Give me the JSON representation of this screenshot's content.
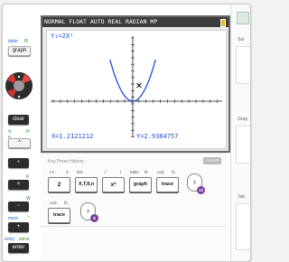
{
  "screen": {
    "status": "NORMAL FLOAT AUTO REAL RADIAN MP",
    "equation": "Y₁=2X²",
    "x_readout": "X=1.2121212",
    "y_readout": "Y=2.9384757",
    "curve_color": "#1f4fd0"
  },
  "keypad": {
    "table_label": "table",
    "f5_label": "f5",
    "graph_label": "graph",
    "clear_label": "clear",
    "pi_label": "π",
    "h_label": "H",
    "e_label": "e",
    "caret_label": "^",
    "divide_label": "÷",
    "times_label": "×",
    "minus_label": "−",
    "plus_label": "+",
    "k_label": "K",
    "w_label": "W",
    "mem_label": "mem",
    "quote_label": "\"",
    "entry_label": "entry",
    "solve_label": "solve",
    "enter_label": "enter"
  },
  "history": {
    "title": "Key Press History",
    "clear_label": "CLEAR",
    "row1": [
      {
        "sub1": "L2",
        "sub2": "Z",
        "label": "2"
      },
      {
        "sub1": "link",
        "sub2": "",
        "label": "X,T,θ,n"
      },
      {
        "sub1": "√‾",
        "sub2": "I",
        "label": "x²"
      },
      {
        "sub1": "table",
        "sub2": "f5",
        "label": "graph"
      },
      {
        "sub1": "calc",
        "sub2": "f4",
        "label": "trace"
      }
    ],
    "row1_badge": "12",
    "row2": [
      {
        "sub1": "calc",
        "sub2": "f4",
        "label": "trace"
      }
    ],
    "row2_badge": "8",
    "arrow": "›"
  },
  "side": {
    "label1": "Set",
    "label2": "Grap",
    "label3": "Tab"
  }
}
